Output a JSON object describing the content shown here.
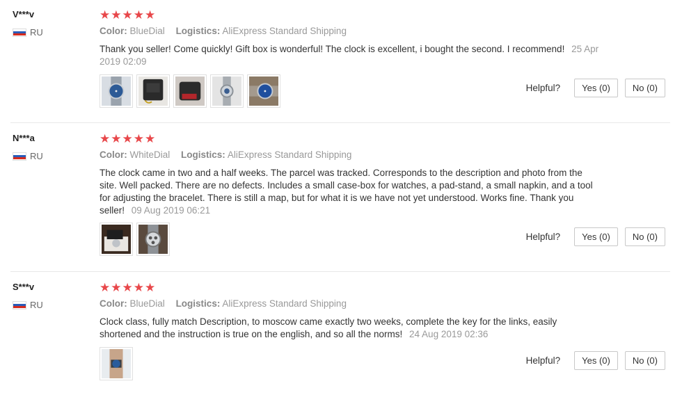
{
  "reviews": [
    {
      "user": "V***v",
      "country": "RU",
      "rating": 5,
      "stars": "★★★★★",
      "color_label": "Color:",
      "color_value": "BlueDial",
      "logistics_label": "Logistics:",
      "logistics_value": "AliExpress Standard Shipping",
      "text": "Thank you seller! Come quickly! Gift box is wonderful! The clock is excellent, i bought the second. I recommend!",
      "date": "25 Apr 2019 02:09",
      "helpful_label": "Helpful?",
      "yes_label": "Yes (0)",
      "no_label": "No (0)"
    },
    {
      "user": "N***a",
      "country": "RU",
      "rating": 5,
      "stars": "★★★★★",
      "color_label": "Color:",
      "color_value": "WhiteDial",
      "logistics_label": "Logistics:",
      "logistics_value": "AliExpress Standard Shipping",
      "text": "The clock came in two and a half weeks. The parcel was tracked. Corresponds to the description and photo from the site. Well packed. There are no defects. Includes a small case-box for watches, a pad-stand, a small napkin, and a tool for adjusting the bracelet. There is still a map, but for what it is we have not yet understood. Works fine. Thank you seller!",
      "date": "09 Aug 2019 06:21",
      "helpful_label": "Helpful?",
      "yes_label": "Yes (0)",
      "no_label": "No (0)"
    },
    {
      "user": "S***v",
      "country": "RU",
      "rating": 5,
      "stars": "★★★★★",
      "color_label": "Color:",
      "color_value": "BlueDial",
      "logistics_label": "Logistics:",
      "logistics_value": "AliExpress Standard Shipping",
      "text": "Clock class, fully match Description, to moscow came exactly two weeks, complete the key for the links, easily shortened and the instruction is true on the english, and so all the norms!",
      "date": "24 Aug 2019 02:36",
      "helpful_label": "Helpful?",
      "yes_label": "Yes (0)",
      "no_label": "No (0)"
    }
  ],
  "colors": {
    "star": "#e8474a",
    "flag_white": "#ffffff",
    "flag_blue": "#2a5cb8",
    "flag_red": "#d52b1e"
  }
}
